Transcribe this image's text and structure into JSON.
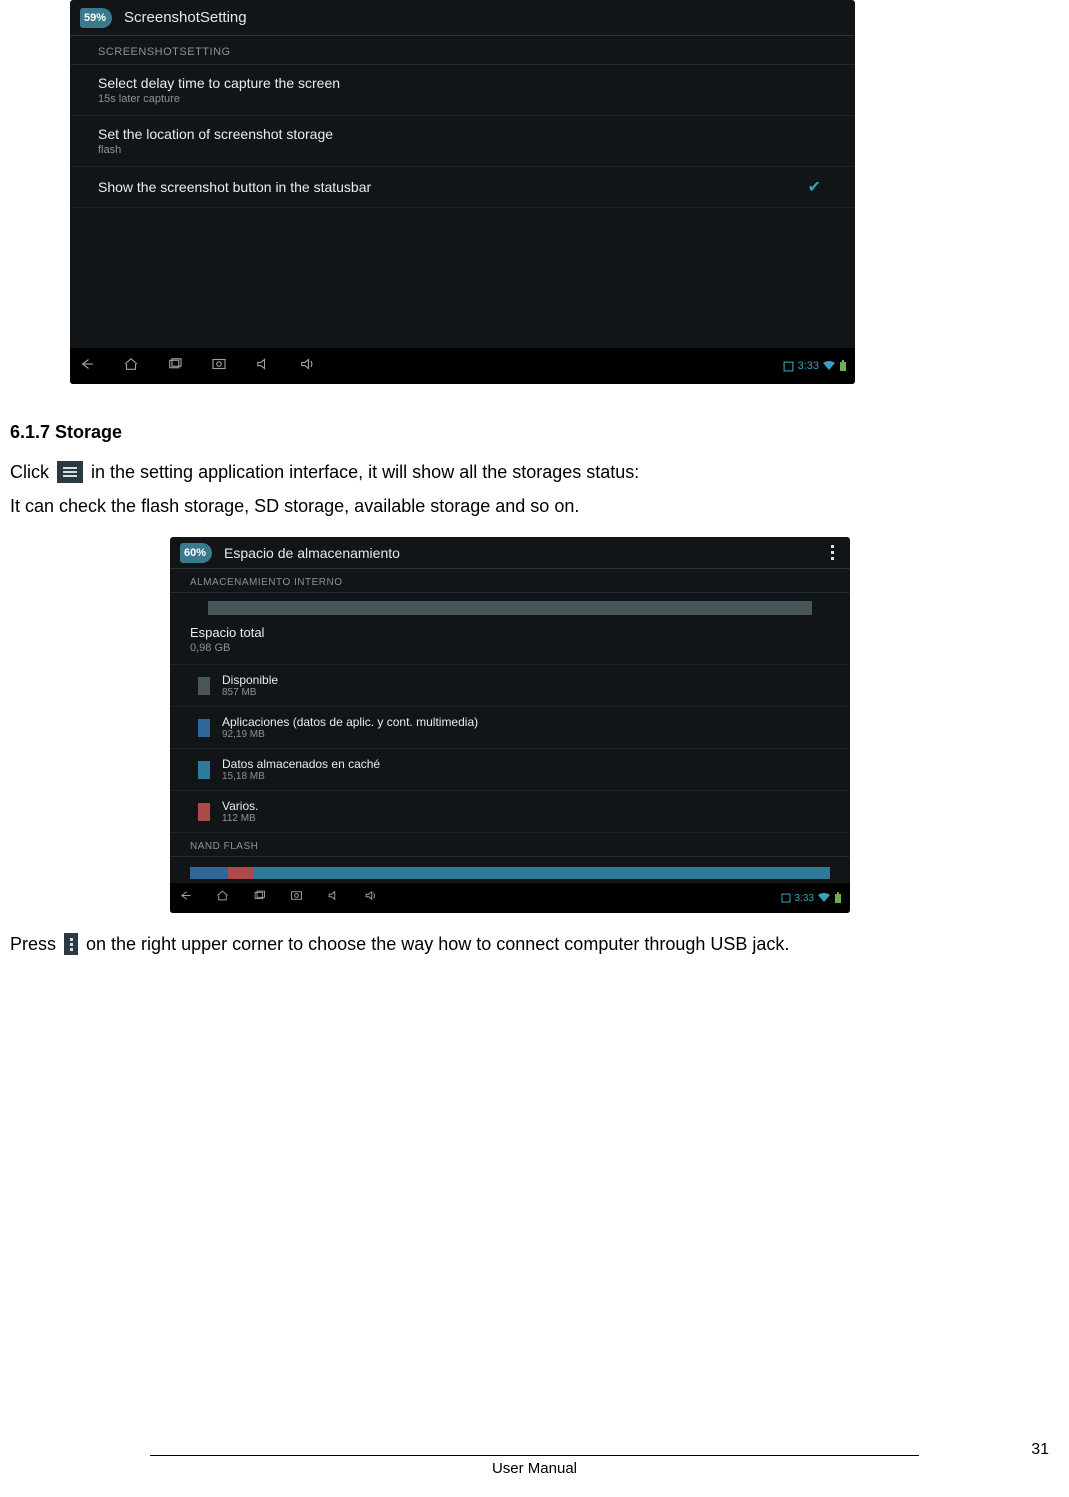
{
  "shot1": {
    "battery": "59%",
    "title": "ScreenshotSetting",
    "section": "SCREENSHOTSETTING",
    "rows": [
      {
        "title": "Select delay time to capture the screen",
        "sub": "15s later capture"
      },
      {
        "title": "Set the location of screenshot storage",
        "sub": "flash"
      },
      {
        "title": "Show the screenshot button in the statusbar",
        "sub": ""
      }
    ],
    "clock": "3:33"
  },
  "doc": {
    "heading": "6.1.7 Storage",
    "p1a": "Click",
    "p1b": "in the setting application interface, it will show all the storages status:",
    "p2": "It can check the flash storage, SD storage, available storage and so on.",
    "p3a": "Press",
    "p3b": "on the right upper corner to choose the way how to connect computer through USB jack."
  },
  "shot2": {
    "battery": "60%",
    "title": "Espacio de almacenamiento",
    "section1": "ALMACENAMIENTO INTERNO",
    "total_label": "Espacio total",
    "total_value": "0,98 GB",
    "items": [
      {
        "color": "#4a555b",
        "title": "Disponible",
        "sub": "857 MB"
      },
      {
        "color": "#2e689a",
        "title": "Aplicaciones (datos de aplic. y cont. multimedia)",
        "sub": "92,19 MB"
      },
      {
        "color": "#2e7a9a",
        "title": "Datos almacenados en caché",
        "sub": "15,18 MB"
      },
      {
        "color": "#b04a4a",
        "title": "Varios.",
        "sub": "112 MB"
      }
    ],
    "section2": "NAND FLASH",
    "nand_segments": [
      {
        "color": "#2e689a",
        "w": "6%"
      },
      {
        "color": "#b04a4a",
        "w": "4%"
      },
      {
        "color": "#2e7a9a",
        "w": "90%"
      }
    ],
    "clock": "3:33"
  },
  "footer": {
    "label": "User Manual",
    "page": "31"
  }
}
